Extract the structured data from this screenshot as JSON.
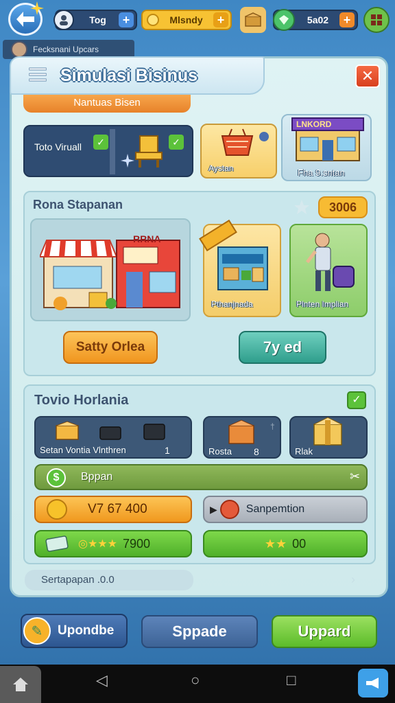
{
  "top": {
    "player_name": "Tog",
    "currency_label": "Mlsndy",
    "gems_value": "5a02"
  },
  "notification": {
    "text": "Fecksnani Upcars"
  },
  "panel": {
    "title": "Simulasi Bisinus",
    "subtitle_tab": "Nantuas Bisen",
    "store_virtual_label": "Toto Viruall",
    "basket_label": "Aystan",
    "shop_label": "Fha 9.sntan",
    "shop_sign": "LNKORD"
  },
  "section1": {
    "title": "Rona Stapanan",
    "badge": "3006",
    "store_sign": "RRNA",
    "market_card_label": "Pthanjnada",
    "worker_card_label": "Plnten Implian",
    "left_button": "Satty Orlea",
    "right_button": "7y ed"
  },
  "section2": {
    "title": "Tovio Horlania",
    "inv_left_label": "Setan Vontia Vlnthren",
    "inv_left_count": "1",
    "inv_mid_label": "Rosta",
    "inv_mid_count": "8",
    "inv_right_label": "Rlak",
    "bar_label": "Bppan",
    "coin_value": "V7 67 400",
    "special_label": "Sanpemtion",
    "rating_value": "7900",
    "rating_value_2": "00"
  },
  "footer_text": "Sertapapan .0.0",
  "bottom_buttons": {
    "left": "Upondbe",
    "middle": "Sppade",
    "right": "Uppard"
  },
  "colors": {
    "orange": "#f39c2c",
    "green": "#5ec23a",
    "teal": "#3fb0a0",
    "blue": "#3e6fae"
  }
}
